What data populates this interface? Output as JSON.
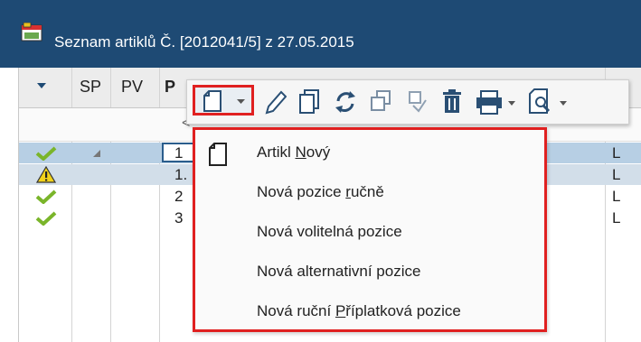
{
  "window": {
    "title": "Seznam artiklů Č. [2012041/5] z 27.05.2015"
  },
  "grid": {
    "columns": [
      "SP",
      "PV",
      "P"
    ],
    "filter_text": "<",
    "rows": [
      {
        "status": "check",
        "number": "1",
        "unit": "L"
      },
      {
        "status": "warning",
        "number": "1.",
        "unit": "L"
      },
      {
        "status": "check",
        "number": "2",
        "unit": "L"
      },
      {
        "status": "check",
        "number": "3",
        "unit": "L"
      }
    ]
  },
  "toolbar": {
    "buttons": [
      "new-document-icon",
      "pencil-icon",
      "copy-icon",
      "refresh-icon",
      "duplicate-icon",
      "restore-icon",
      "trash-icon",
      "printer-icon",
      "preview-icon"
    ]
  },
  "menu": {
    "items": [
      {
        "pre": "Artikl ",
        "key": "N",
        "post": "ový"
      },
      {
        "pre": "Nová pozice ",
        "key": "r",
        "post": "učně"
      },
      {
        "pre": "Nová volitelná pozice",
        "key": "",
        "post": ""
      },
      {
        "pre": "Nová alternativní pozice",
        "key": "",
        "post": ""
      },
      {
        "pre": "Nová ruční ",
        "key": "P",
        "post": "říplatková pozice"
      }
    ]
  },
  "colors": {
    "titlebar": "#1e4a74",
    "highlight": "#e02020",
    "selected_row": "#b7cfe4"
  }
}
